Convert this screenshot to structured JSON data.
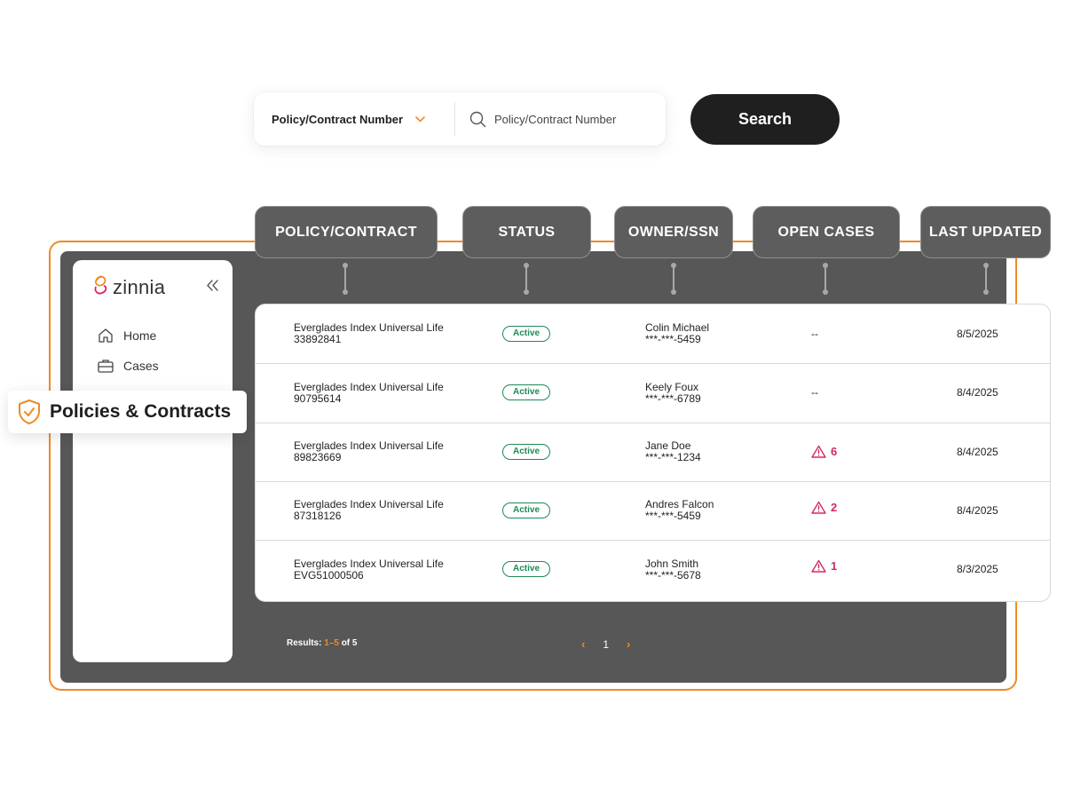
{
  "search": {
    "type_label": "Policy/Contract Number",
    "placeholder": "Policy/Contract Number",
    "button_label": "Search"
  },
  "columns": [
    "POLICY/CONTRACT",
    "STATUS",
    "OWNER/SSN",
    "OPEN CASES",
    "LAST UPDATED"
  ],
  "sidebar": {
    "logo_text": "zinnia",
    "items": [
      {
        "label": "Home"
      },
      {
        "label": "Cases"
      },
      {
        "label": "Policies & Contracts"
      }
    ]
  },
  "rows": [
    {
      "product": "Everglades Index Universal Life",
      "number": "33892841",
      "status": "Active",
      "owner": "Colin Michael",
      "ssn": "***-***-5459",
      "cases": "--",
      "alert": false,
      "updated": "8/5/2025"
    },
    {
      "product": "Everglades Index Universal Life",
      "number": "90795614",
      "status": "Active",
      "owner": "Keely Foux",
      "ssn": "***-***-6789",
      "cases": "--",
      "alert": false,
      "updated": "8/4/2025"
    },
    {
      "product": "Everglades Index Universal Life",
      "number": "89823669",
      "status": "Active",
      "owner": "Jane Doe",
      "ssn": "***-***-1234",
      "cases": "6",
      "alert": true,
      "updated": "8/4/2025"
    },
    {
      "product": "Everglades Index Universal Life",
      "number": "87318126",
      "status": "Active",
      "owner": "Andres Falcon",
      "ssn": "***-***-5459",
      "cases": "2",
      "alert": true,
      "updated": "8/4/2025"
    },
    {
      "product": "Everglades Index Universal Life",
      "number": "EVG51000506",
      "status": "Active",
      "owner": "John Smith",
      "ssn": "***-***-5678",
      "cases": "1",
      "alert": true,
      "updated": "8/3/2025"
    }
  ],
  "footer": {
    "results_prefix": "Results: ",
    "results_range": "1–5",
    "results_suffix": " of 5",
    "page": "1",
    "prev_glyph": "‹",
    "next_glyph": "›"
  },
  "colors": {
    "accent": "#f08a24",
    "dark": "#1f1f1f",
    "status_green": "#1e8a55",
    "alert_pink": "#d42a62",
    "panel": "#575757"
  },
  "icons": [
    "chevron-down-icon",
    "search-icon",
    "zinnia-logo-icon",
    "collapse-icon",
    "home-icon",
    "briefcase-icon",
    "shield-check-icon",
    "warning-icon"
  ]
}
